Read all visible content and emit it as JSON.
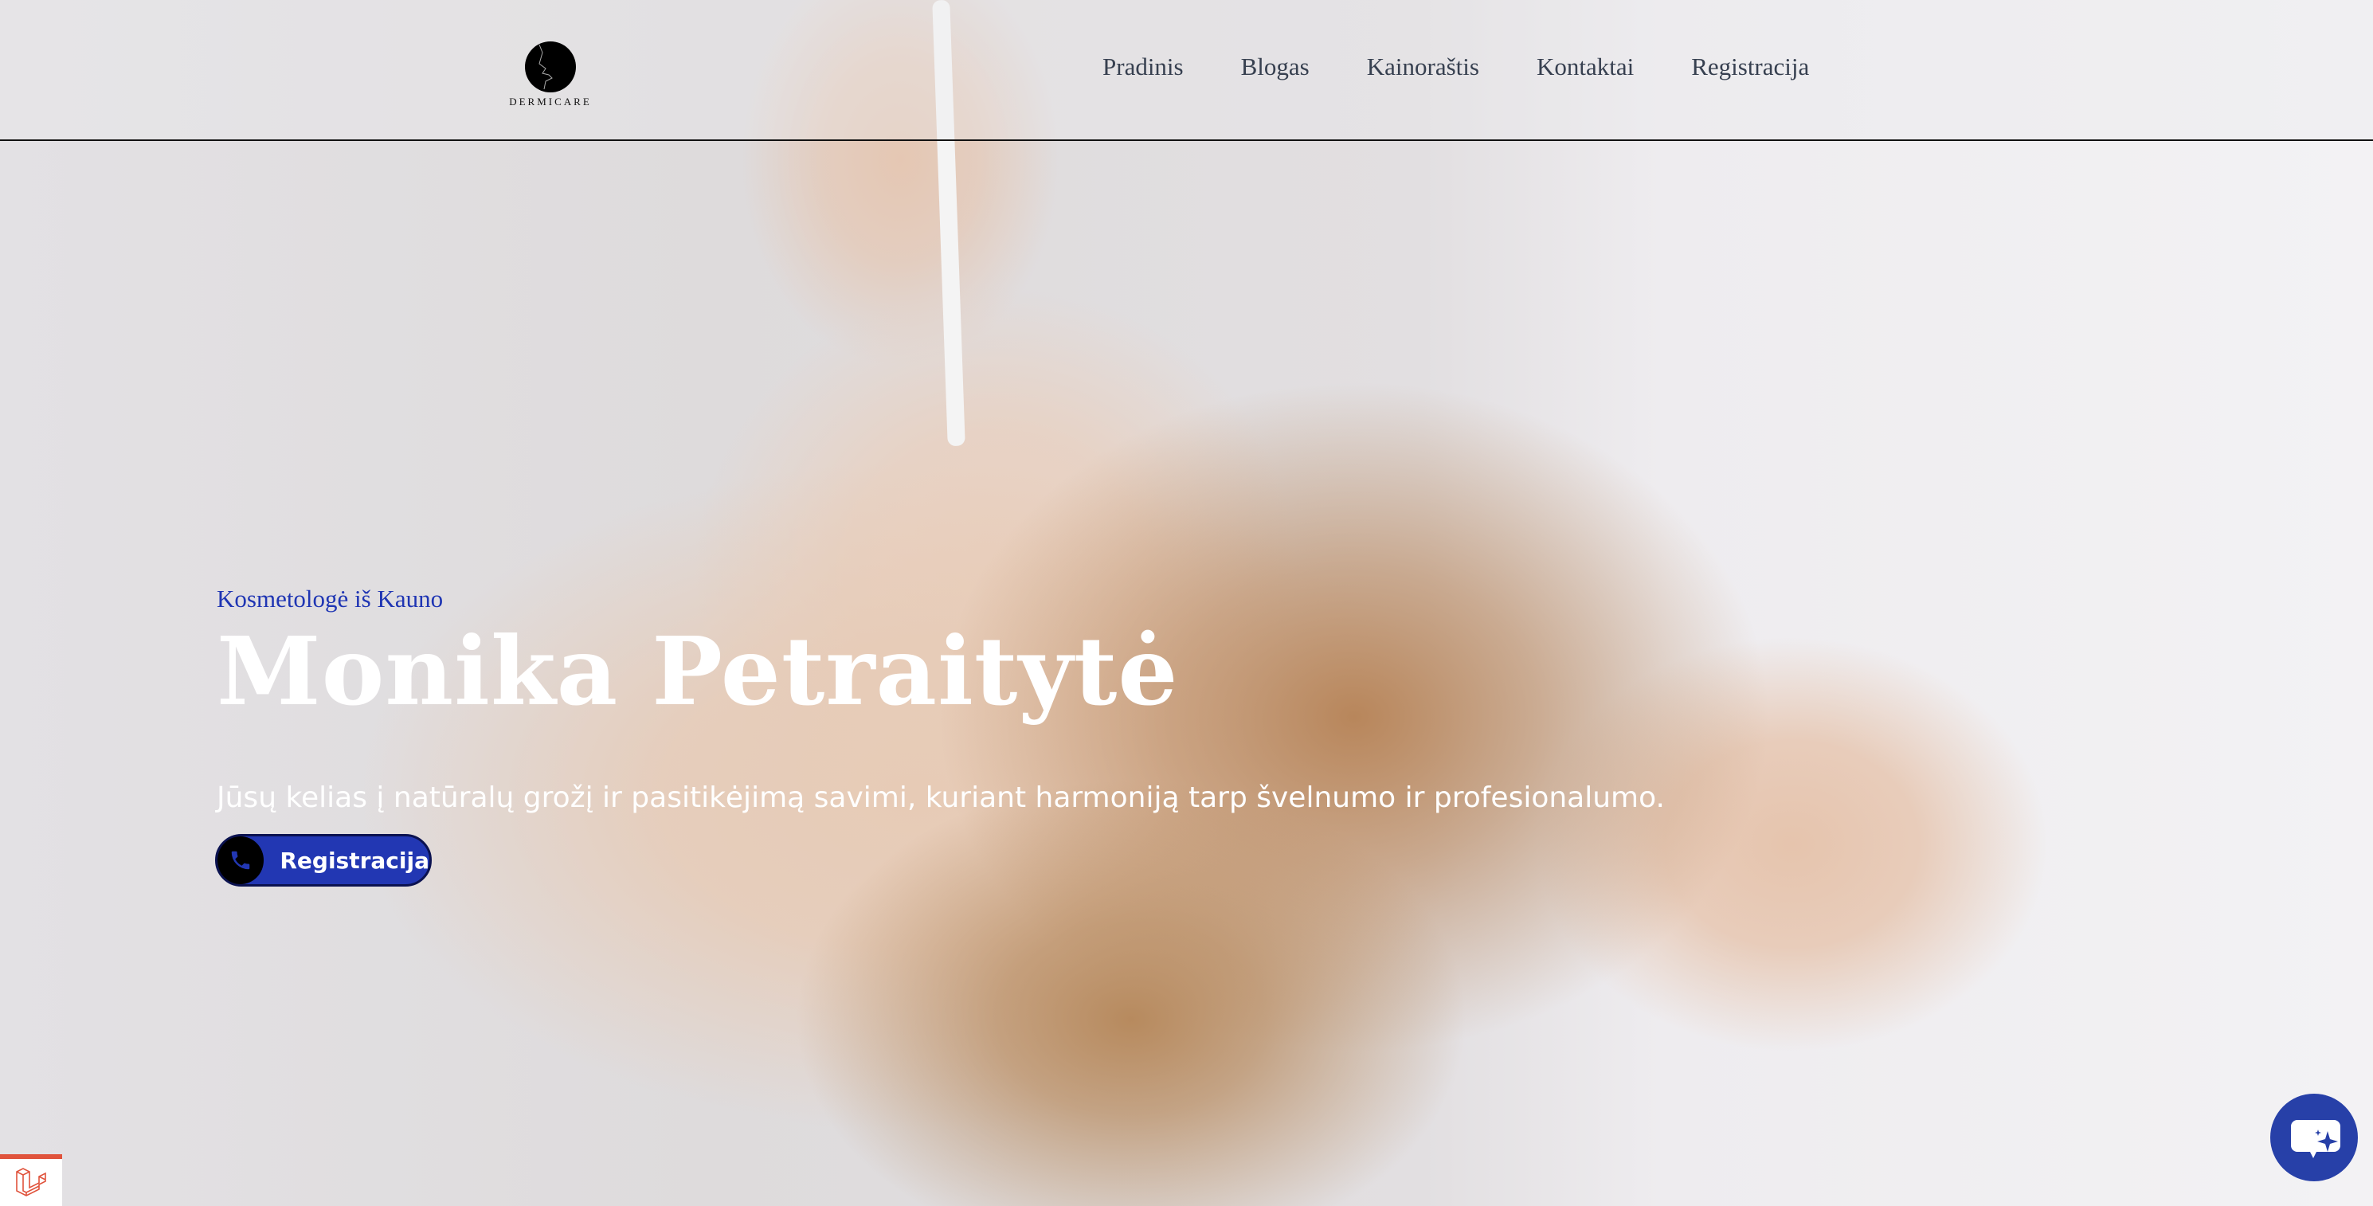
{
  "header": {
    "logo_text": "DERMICARE",
    "nav": [
      {
        "label": "Pradinis"
      },
      {
        "label": "Blogas"
      },
      {
        "label": "Kainoraštis"
      },
      {
        "label": "Kontaktai"
      },
      {
        "label": "Registracija"
      }
    ]
  },
  "hero": {
    "kicker": "Kosmetologė iš Kauno",
    "title": "Monika Petraitytė",
    "tagline": "Jūsų kelias į natūralų grožį ir pasitikėjimą savimi, kuriant harmoniją tarp švelnumo ir profesionalumo.",
    "cta_label": "Registracija",
    "cta_icon": "phone-icon"
  },
  "widgets": {
    "chat_icon": "chat-sparkle-icon",
    "framework_icon": "laravel-icon"
  },
  "colors": {
    "accent": "#2237b3",
    "nav_text": "#374050",
    "chat": "#2740a8",
    "laravel": "#e0533c"
  }
}
